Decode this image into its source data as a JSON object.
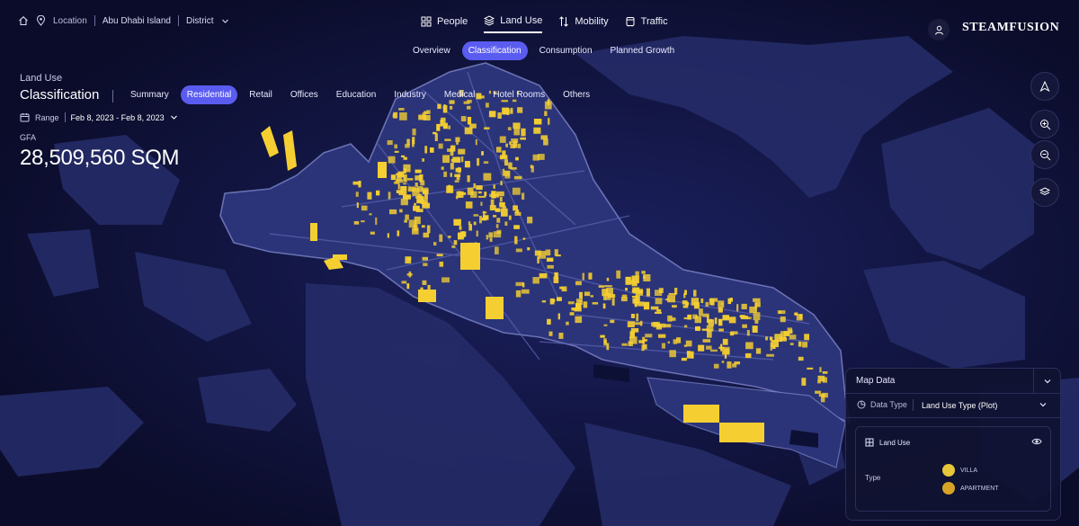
{
  "breadcrumb": {
    "location_label": "Location",
    "island": "Abu Dhabi Island",
    "district": "District"
  },
  "main_nav": [
    {
      "label": "People",
      "icon": "people-icon",
      "active": false
    },
    {
      "label": "Land Use",
      "icon": "layers-icon",
      "active": true
    },
    {
      "label": "Mobility",
      "icon": "mobility-icon",
      "active": false
    },
    {
      "label": "Traffic",
      "icon": "traffic-icon",
      "active": false
    }
  ],
  "sub_nav": [
    "Overview",
    "Classification",
    "Consumption",
    "Planned Growth"
  ],
  "sub_nav_active": "Classification",
  "brand": "STEAMFUSION",
  "header": {
    "section": "Land Use",
    "title": "Classification"
  },
  "categories": [
    "Summary",
    "Residential",
    "Retail",
    "Offices",
    "Education",
    "Industry",
    "Medical",
    "Hotel Rooms",
    "Others"
  ],
  "categories_active": "Residential",
  "range": {
    "label": "Range",
    "value": "Feb 8, 2023 - Feb 8, 2023"
  },
  "metric": {
    "label": "GFA",
    "value": "28,509,560 SQM"
  },
  "map_controls": [
    "compass-icon",
    "zoom-in-icon",
    "zoom-out-icon",
    "layers-icon"
  ],
  "map_data": {
    "title": "Map Data",
    "data_type_label": "Data Type",
    "data_type_value": "Land Use Type (Plot)",
    "layer_label": "Land Use",
    "type_label": "Type",
    "legend": [
      {
        "label": "VILLA",
        "color": "#e8c63a"
      },
      {
        "label": "APARTMENT",
        "color": "#d8a227"
      }
    ]
  },
  "colors": {
    "accent": "#5a5cf0",
    "plot_yellow": "#f5cf32",
    "map_water": "#0b0c2a",
    "map_land": "#2a3378"
  }
}
